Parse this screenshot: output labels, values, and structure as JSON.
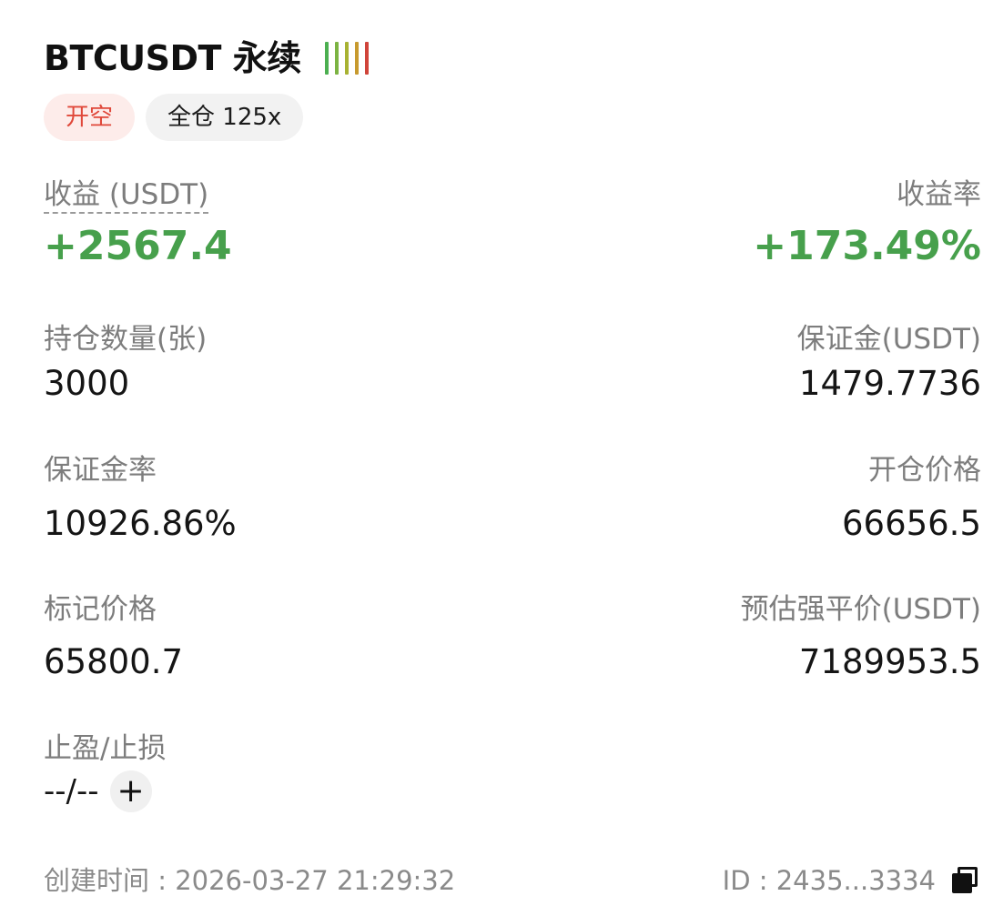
{
  "position": {
    "symbol": "BTCUSDT 永续",
    "signal_bar_colors": [
      "#4caf50",
      "#7cb342",
      "#a8b232",
      "#c79a2e",
      "#d0443a"
    ],
    "side_tag": "开空",
    "mode_tag": "全仓 125x"
  },
  "pnl": {
    "label": "收益 (USDT)",
    "value": "+2567.4",
    "rate_label": "收益率",
    "rate_value": "+173.49%",
    "color": "#47a04c"
  },
  "fields": {
    "size_label": "持仓数量(张)",
    "size_value": "3000",
    "margin_label": "保证金(USDT)",
    "margin_value": "1479.7736",
    "margin_ratio_label": "保证金率",
    "margin_ratio_value": "10926.86%",
    "entry_price_label": "开仓价格",
    "entry_price_value": "66656.5",
    "mark_price_label": "标记价格",
    "mark_price_value": "65800.7",
    "liq_price_label": "预估强平价(USDT)",
    "liq_price_value": "7189953.5",
    "tpsl_label": "止盈/止损",
    "tpsl_value": "--/--",
    "tpsl_add": "+"
  },
  "footer": {
    "created": "创建时间 : 2026-03-27 21:29:32",
    "id": "ID : 2435...3334"
  },
  "colors": {
    "side_short": "#e0483a",
    "side_short_bg": "#fdecea",
    "label_gray": "#7d7d7d"
  }
}
